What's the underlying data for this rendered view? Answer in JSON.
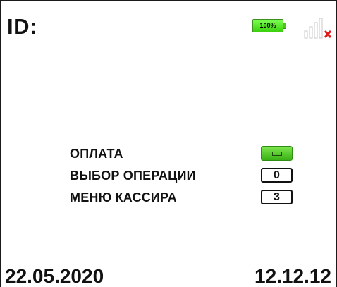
{
  "header": {
    "id_label": "ID:",
    "battery": {
      "level_text": "100%",
      "level_percent": 100,
      "color": "#4cd41c",
      "icon": "battery-icon"
    },
    "signal": {
      "icon": "signal-icon",
      "status": "no-connection",
      "x_color": "#e01b1b"
    }
  },
  "menu": {
    "items": [
      {
        "label": "ОПЛАТА",
        "key_label": "",
        "key_icon": "enter-key-icon",
        "key_color": "#4cc41c"
      },
      {
        "label": "ВЫБОР ОПЕРАЦИИ",
        "key_label": "0"
      },
      {
        "label": "МЕНЮ КАССИРА",
        "key_label": "3"
      }
    ]
  },
  "footer": {
    "date": "22.05.2020",
    "time": "12.12.12"
  }
}
